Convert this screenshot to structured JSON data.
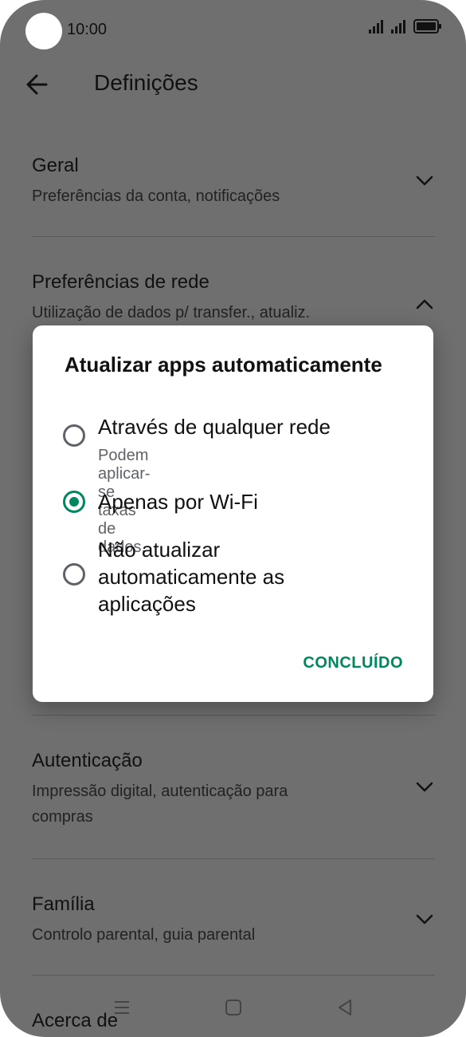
{
  "status_bar": {
    "time": "10:00"
  },
  "app_bar": {
    "title": "Definições"
  },
  "settings": [
    {
      "title": "Geral",
      "subtitle": "Preferências da conta, notificações"
    },
    {
      "title": "Preferências de rede",
      "subtitle": "Utilização de dados p/ transfer., atualiz."
    },
    {
      "title": "Autenticação",
      "subtitle": "Impressão digital, autenticação para compras"
    },
    {
      "title": "Família",
      "subtitle": "Controlo parental, guia parental"
    },
    {
      "title": "Acerca de"
    }
  ],
  "dialog": {
    "title": "Atualizar apps automaticamente",
    "options": [
      {
        "label": "Através de qualquer rede",
        "sublabel": "Podem aplicar-se taxas de dados.",
        "selected": false
      },
      {
        "label": "Apenas por Wi-Fi",
        "selected": true
      },
      {
        "label": "Não atualizar automaticamente as aplicações",
        "selected": false
      }
    ],
    "done_label": "CONCLUÍDO"
  },
  "colors": {
    "accent": "#01875f",
    "scrim": "#6f6f6f"
  }
}
